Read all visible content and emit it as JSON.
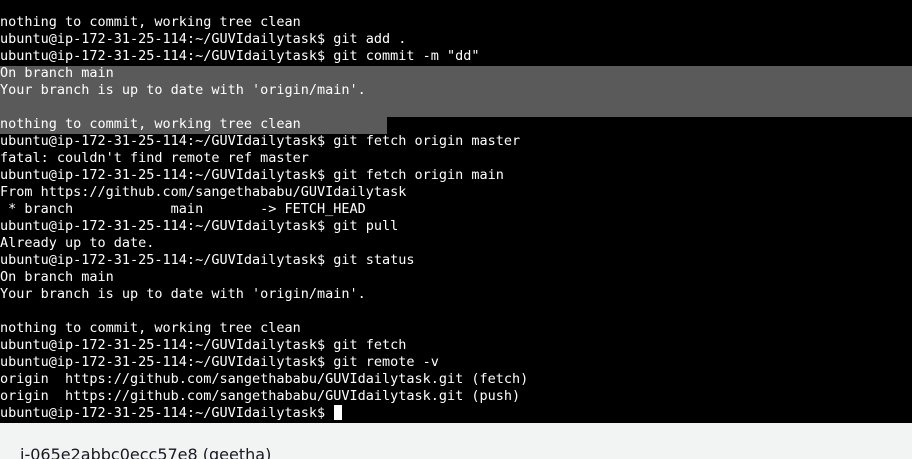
{
  "terminal": {
    "lines": [
      "nothing to commit, working tree clean",
      "ubuntu@ip-172-31-25-114:~/GUVIdailytask$ git add .",
      "ubuntu@ip-172-31-25-114:~/GUVIdailytask$ git commit -m \"dd\"",
      "On branch main",
      "Your branch is up to date with 'origin/main'.",
      "",
      "nothing to commit, working tree clean",
      "ubuntu@ip-172-31-25-114:~/GUVIdailytask$ git fetch origin master",
      "fatal: couldn't find remote ref master",
      "ubuntu@ip-172-31-25-114:~/GUVIdailytask$ git fetch origin main",
      "From https://github.com/sangethababu/GUVIdailytask",
      " * branch            main       -> FETCH_HEAD",
      "ubuntu@ip-172-31-25-114:~/GUVIdailytask$ git pull",
      "Already up to date.",
      "ubuntu@ip-172-31-25-114:~/GUVIdailytask$ git status",
      "On branch main",
      "Your branch is up to date with 'origin/main'.",
      "",
      "nothing to commit, working tree clean",
      "ubuntu@ip-172-31-25-114:~/GUVIdailytask$ git fetch",
      "ubuntu@ip-172-31-25-114:~/GUVIdailytask$ git remote -v",
      "origin  https://github.com/sangethababu/GUVIdailytask.git (fetch)",
      "origin  https://github.com/sangethababu/GUVIdailytask.git (push)",
      "ubuntu@ip-172-31-25-114:~/GUVIdailytask$ "
    ],
    "colors": {
      "background": "#000000",
      "foreground": "#ffffff",
      "selection": "#5a5a5a"
    }
  },
  "footer": {
    "instance_label": "i-065e2abbc0ecc57e8 (geetha)"
  }
}
